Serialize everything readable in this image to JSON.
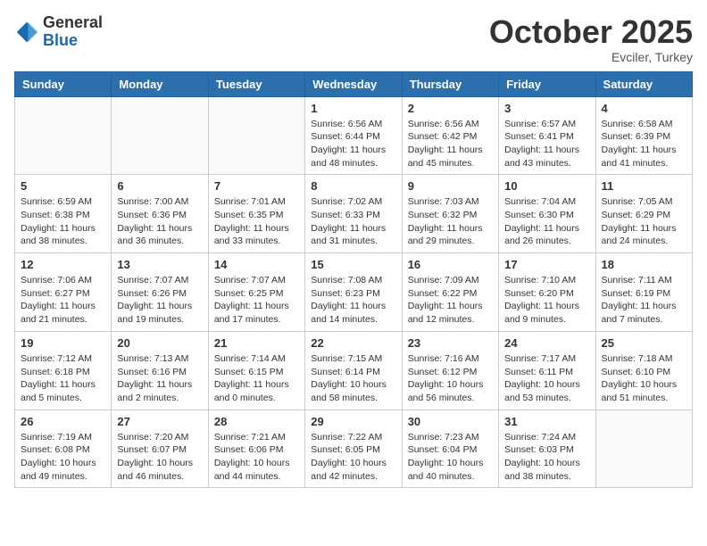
{
  "logo": {
    "general": "General",
    "blue": "Blue"
  },
  "header": {
    "month": "October 2025",
    "location": "Evciler, Turkey"
  },
  "days_of_week": [
    "Sunday",
    "Monday",
    "Tuesday",
    "Wednesday",
    "Thursday",
    "Friday",
    "Saturday"
  ],
  "weeks": [
    [
      {
        "day": "",
        "info": ""
      },
      {
        "day": "",
        "info": ""
      },
      {
        "day": "",
        "info": ""
      },
      {
        "day": "1",
        "info": "Sunrise: 6:56 AM\nSunset: 6:44 PM\nDaylight: 11 hours and 48 minutes."
      },
      {
        "day": "2",
        "info": "Sunrise: 6:56 AM\nSunset: 6:42 PM\nDaylight: 11 hours and 45 minutes."
      },
      {
        "day": "3",
        "info": "Sunrise: 6:57 AM\nSunset: 6:41 PM\nDaylight: 11 hours and 43 minutes."
      },
      {
        "day": "4",
        "info": "Sunrise: 6:58 AM\nSunset: 6:39 PM\nDaylight: 11 hours and 41 minutes."
      }
    ],
    [
      {
        "day": "5",
        "info": "Sunrise: 6:59 AM\nSunset: 6:38 PM\nDaylight: 11 hours and 38 minutes."
      },
      {
        "day": "6",
        "info": "Sunrise: 7:00 AM\nSunset: 6:36 PM\nDaylight: 11 hours and 36 minutes."
      },
      {
        "day": "7",
        "info": "Sunrise: 7:01 AM\nSunset: 6:35 PM\nDaylight: 11 hours and 33 minutes."
      },
      {
        "day": "8",
        "info": "Sunrise: 7:02 AM\nSunset: 6:33 PM\nDaylight: 11 hours and 31 minutes."
      },
      {
        "day": "9",
        "info": "Sunrise: 7:03 AM\nSunset: 6:32 PM\nDaylight: 11 hours and 29 minutes."
      },
      {
        "day": "10",
        "info": "Sunrise: 7:04 AM\nSunset: 6:30 PM\nDaylight: 11 hours and 26 minutes."
      },
      {
        "day": "11",
        "info": "Sunrise: 7:05 AM\nSunset: 6:29 PM\nDaylight: 11 hours and 24 minutes."
      }
    ],
    [
      {
        "day": "12",
        "info": "Sunrise: 7:06 AM\nSunset: 6:27 PM\nDaylight: 11 hours and 21 minutes."
      },
      {
        "day": "13",
        "info": "Sunrise: 7:07 AM\nSunset: 6:26 PM\nDaylight: 11 hours and 19 minutes."
      },
      {
        "day": "14",
        "info": "Sunrise: 7:07 AM\nSunset: 6:25 PM\nDaylight: 11 hours and 17 minutes."
      },
      {
        "day": "15",
        "info": "Sunrise: 7:08 AM\nSunset: 6:23 PM\nDaylight: 11 hours and 14 minutes."
      },
      {
        "day": "16",
        "info": "Sunrise: 7:09 AM\nSunset: 6:22 PM\nDaylight: 11 hours and 12 minutes."
      },
      {
        "day": "17",
        "info": "Sunrise: 7:10 AM\nSunset: 6:20 PM\nDaylight: 11 hours and 9 minutes."
      },
      {
        "day": "18",
        "info": "Sunrise: 7:11 AM\nSunset: 6:19 PM\nDaylight: 11 hours and 7 minutes."
      }
    ],
    [
      {
        "day": "19",
        "info": "Sunrise: 7:12 AM\nSunset: 6:18 PM\nDaylight: 11 hours and 5 minutes."
      },
      {
        "day": "20",
        "info": "Sunrise: 7:13 AM\nSunset: 6:16 PM\nDaylight: 11 hours and 2 minutes."
      },
      {
        "day": "21",
        "info": "Sunrise: 7:14 AM\nSunset: 6:15 PM\nDaylight: 11 hours and 0 minutes."
      },
      {
        "day": "22",
        "info": "Sunrise: 7:15 AM\nSunset: 6:14 PM\nDaylight: 10 hours and 58 minutes."
      },
      {
        "day": "23",
        "info": "Sunrise: 7:16 AM\nSunset: 6:12 PM\nDaylight: 10 hours and 56 minutes."
      },
      {
        "day": "24",
        "info": "Sunrise: 7:17 AM\nSunset: 6:11 PM\nDaylight: 10 hours and 53 minutes."
      },
      {
        "day": "25",
        "info": "Sunrise: 7:18 AM\nSunset: 6:10 PM\nDaylight: 10 hours and 51 minutes."
      }
    ],
    [
      {
        "day": "26",
        "info": "Sunrise: 7:19 AM\nSunset: 6:08 PM\nDaylight: 10 hours and 49 minutes."
      },
      {
        "day": "27",
        "info": "Sunrise: 7:20 AM\nSunset: 6:07 PM\nDaylight: 10 hours and 46 minutes."
      },
      {
        "day": "28",
        "info": "Sunrise: 7:21 AM\nSunset: 6:06 PM\nDaylight: 10 hours and 44 minutes."
      },
      {
        "day": "29",
        "info": "Sunrise: 7:22 AM\nSunset: 6:05 PM\nDaylight: 10 hours and 42 minutes."
      },
      {
        "day": "30",
        "info": "Sunrise: 7:23 AM\nSunset: 6:04 PM\nDaylight: 10 hours and 40 minutes."
      },
      {
        "day": "31",
        "info": "Sunrise: 7:24 AM\nSunset: 6:03 PM\nDaylight: 10 hours and 38 minutes."
      },
      {
        "day": "",
        "info": ""
      }
    ]
  ]
}
